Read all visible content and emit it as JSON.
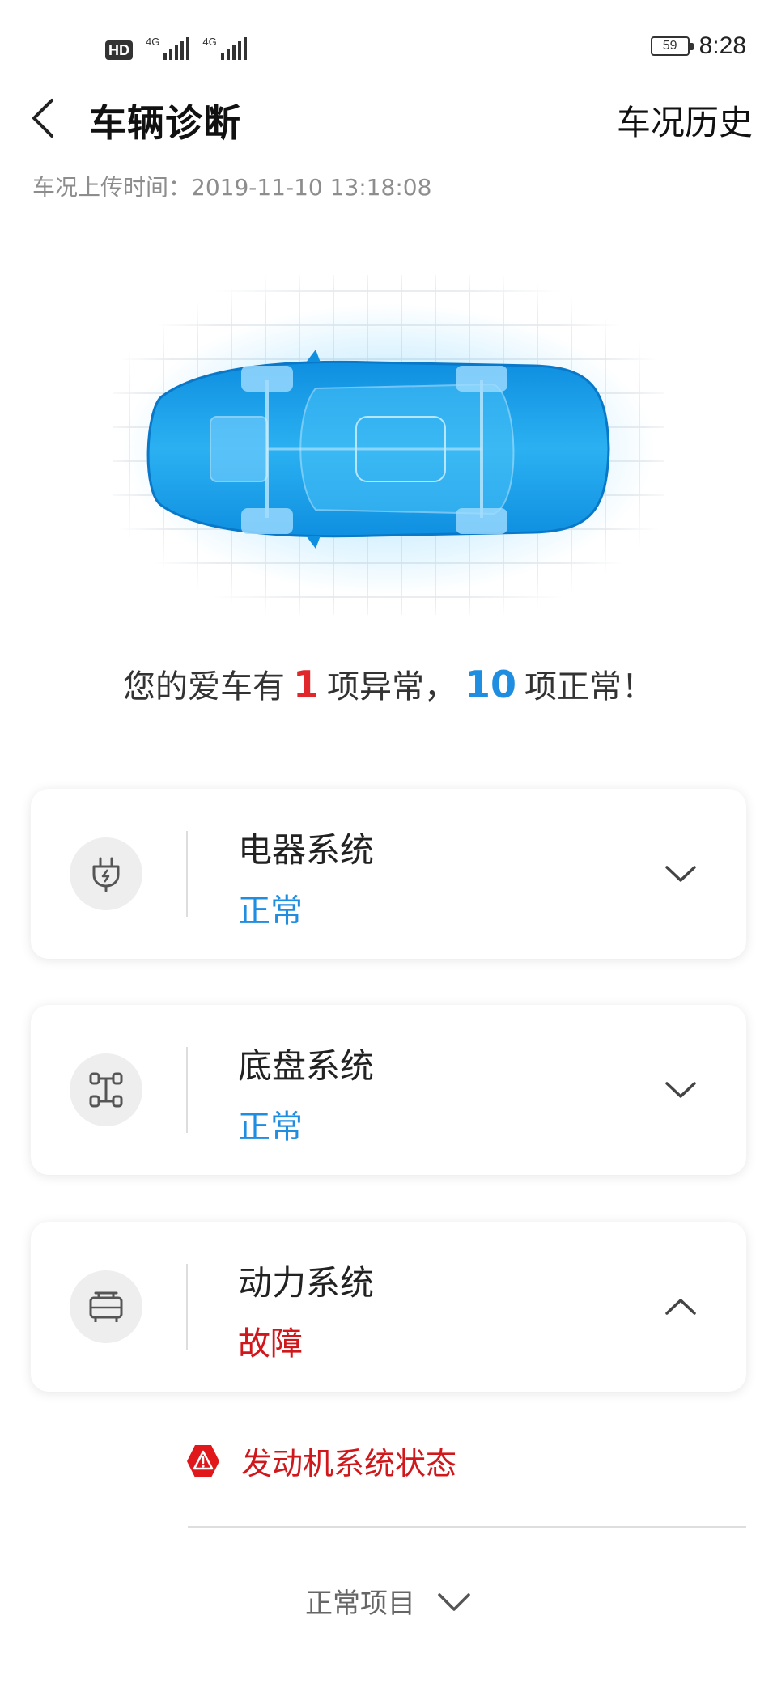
{
  "status_bar": {
    "hd_label": "HD",
    "signal_1_label": "4G",
    "signal_2_label": "4G",
    "battery_level": "59",
    "time": "8:28"
  },
  "header": {
    "title": "车辆诊断",
    "history_link": "车况历史"
  },
  "upload_time": "车况上传时间：2019-11-10 13:18:08",
  "summary": {
    "prefix": "您的爱车有",
    "abnormal_count": "1",
    "middle": "项异常，",
    "normal_count": "10",
    "suffix": "项正常！"
  },
  "systems": [
    {
      "name": "电器系统",
      "status": "正常",
      "icon": "plug-icon",
      "expanded": false
    },
    {
      "name": "底盘系统",
      "status": "正常",
      "icon": "chassis-icon",
      "expanded": false
    },
    {
      "name": "动力系统",
      "status": "故障",
      "icon": "engine-icon",
      "expanded": true
    }
  ],
  "fault_items": [
    {
      "label": "发动机系统状态",
      "icon": "warning-icon"
    }
  ],
  "normal_items_toggle": "正常项目",
  "colors": {
    "ok_blue": "#1f8de0",
    "fault_red": "#d0181c",
    "summary_red": "#e0282c",
    "car_blue": "#1aa0ec"
  }
}
